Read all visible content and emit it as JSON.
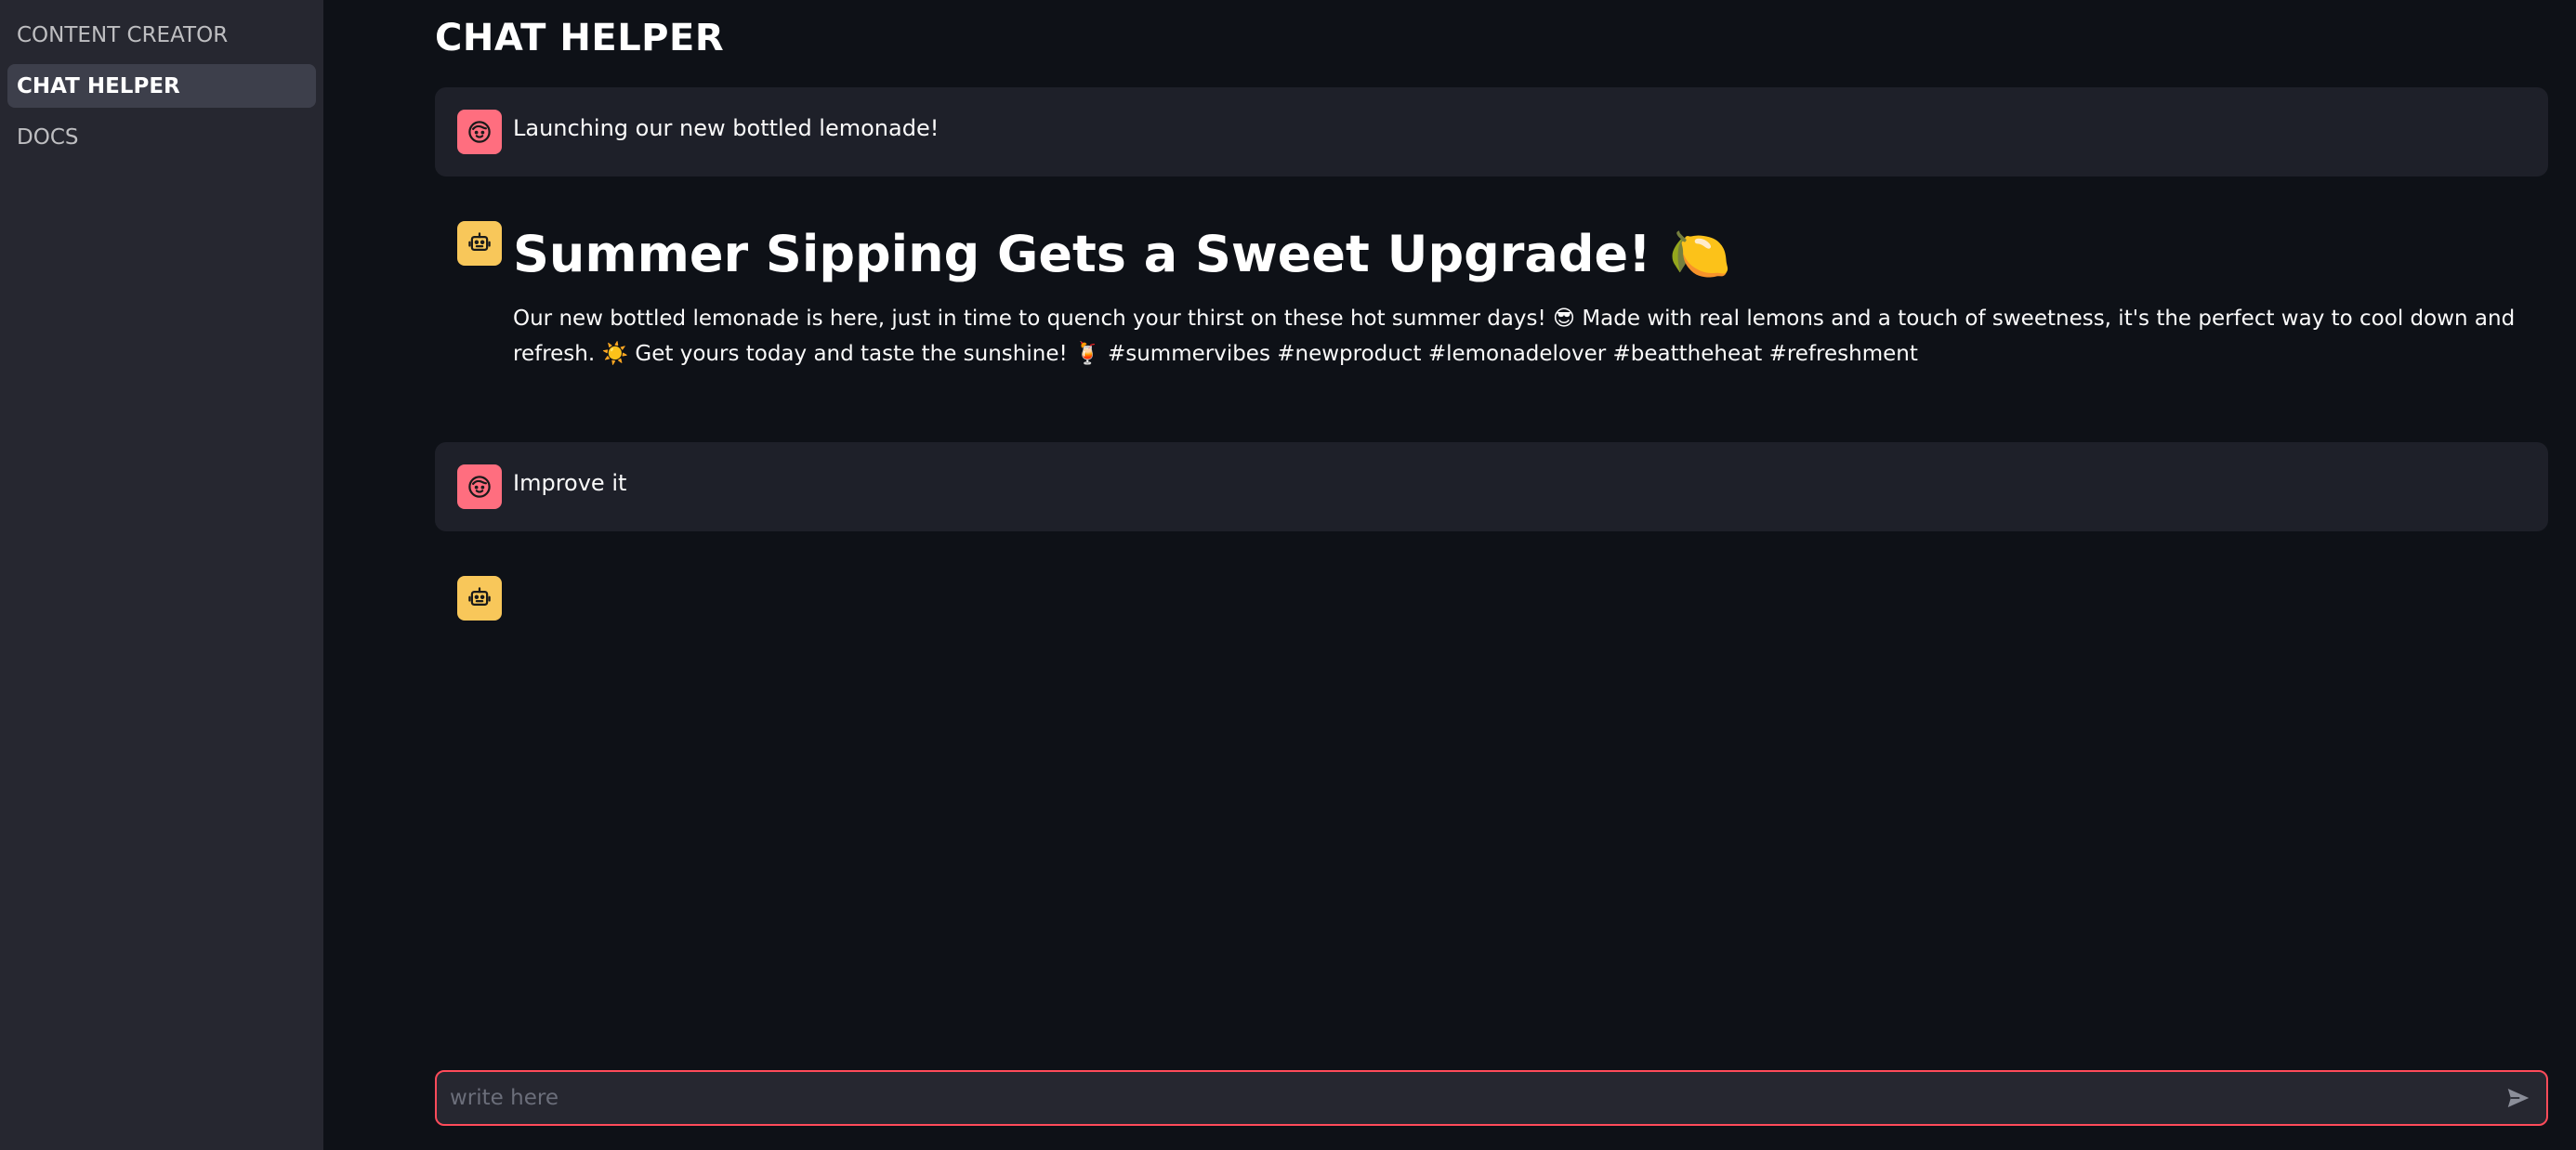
{
  "sidebar": {
    "items": [
      {
        "label": "CONTENT CREATOR",
        "active": false
      },
      {
        "label": "CHAT HELPER",
        "active": true
      },
      {
        "label": "DOCS",
        "active": false
      }
    ]
  },
  "main": {
    "title": "CHAT HELPER",
    "messages": [
      {
        "role": "user",
        "avatar": "user-face-icon",
        "text": "Launching our new bottled lemonade!"
      },
      {
        "role": "assistant",
        "avatar": "robot-icon",
        "heading": "Summer Sipping Gets a Sweet Upgrade! 🍋",
        "body": "Our new bottled lemonade is here, just in time to quench your thirst on these hot summer days! 😎 Made with real lemons and a touch of sweetness, it's the perfect way to cool down and refresh. ☀️ Get yours today and taste the sunshine! 🍹 #summervibes #newproduct #lemonadelover #beattheheat #refreshment"
      },
      {
        "role": "user",
        "avatar": "user-face-icon",
        "text": "Improve it"
      },
      {
        "role": "assistant",
        "avatar": "robot-icon",
        "text": ""
      }
    ]
  },
  "chat_input": {
    "placeholder": "write here",
    "value": "",
    "send_icon": "send-icon"
  },
  "colors": {
    "background": "#0e1117",
    "sidebar": "#262730",
    "user_avatar": "#ff6e7f",
    "bot_avatar": "#f8c75a",
    "input_border": "#ff4b5a"
  }
}
